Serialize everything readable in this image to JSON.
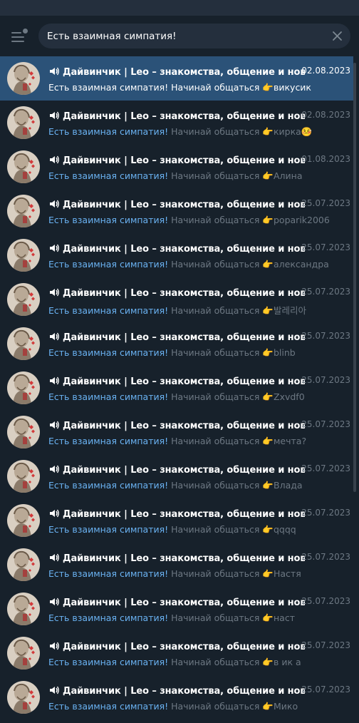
{
  "search": {
    "value": "Есть взаимная симпатия!"
  },
  "chat_title": "Дайвинчик | Leo – знакомства, общение и новые…",
  "message_highlight": "Есть взаимная симпатия!",
  "message_prefix": " Начинай общаться ",
  "pointing_emoji": "👉",
  "results": [
    {
      "date": "02.08.2023",
      "name": "викусик",
      "selected": true
    },
    {
      "date": "02.08.2023",
      "name": "кирка🤒"
    },
    {
      "date": "01.08.2023",
      "name": "Алина"
    },
    {
      "date": "25.07.2023",
      "name": "poparik2006"
    },
    {
      "date": "25.07.2023",
      "name": "александра"
    },
    {
      "date": "25.07.2023",
      "name": "발레리아"
    },
    {
      "date": "25.07.2023",
      "name": "blinb"
    },
    {
      "date": "25.07.2023",
      "name": "Zxvdf0"
    },
    {
      "date": "25.07.2023",
      "name": "мечта?"
    },
    {
      "date": "25.07.2023",
      "name": "Влада"
    },
    {
      "date": "25.07.2023",
      "name": "qqqq"
    },
    {
      "date": "25.07.2023",
      "name": "Настя"
    },
    {
      "date": "25.07.2023",
      "name": "наст"
    },
    {
      "date": "25.07.2023",
      "name": "в ик а"
    },
    {
      "date": "25.07.2023",
      "name": "Мико"
    }
  ],
  "icons": {
    "menu": "hamburger-menu-icon",
    "clear": "close-icon",
    "channel": "speaker-icon",
    "avatar": "leo-avatar"
  },
  "colors": {
    "background": "#17212b",
    "search_bg": "#242f3d",
    "selected_row": "#2b5278",
    "highlight": "#6ab2f2",
    "muted": "#6d7883"
  }
}
